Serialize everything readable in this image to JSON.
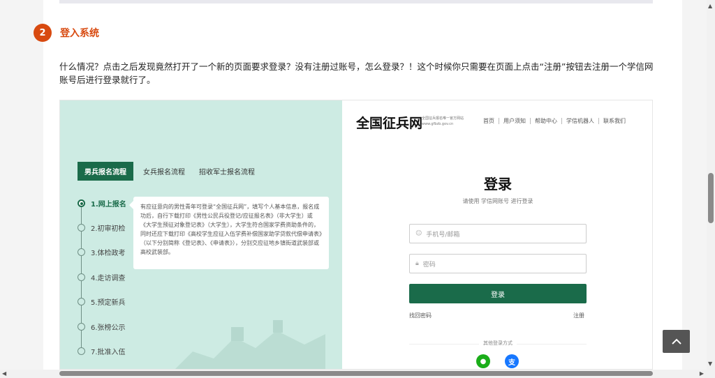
{
  "section": {
    "number": "2",
    "title": "登入系统"
  },
  "paragraph": "什么情况？点击之后发现竟然打开了一个新的页面要求登录？没有注册过账号，怎么登录？！这个时候你只需要在页面上点击“注册”按钮去注册一个学信网账号后进行登录就行了。",
  "screenshot": {
    "tabs": [
      "男兵报名流程",
      "女兵报名流程",
      "招收军士报名流程"
    ],
    "steps": [
      "1.网上报名",
      "2.初审初检",
      "3.体检政考",
      "4.走访调查",
      "5.预定新兵",
      "6.张榜公示",
      "7.批准入伍"
    ],
    "info_text": "有应征意向的男性青年可登录“全国征兵网”，填写个人基本信息，报名成功后，自行下载打印《男性公民兵役登记/应征报名表》（非大学生）或《大学生预征对象登记表》（大学生），大学生符合国家学费资助条件的，同时还应下载打印《高校学生应征入伍学费补偿国家助学贷款代偿申请表》（以下分别简称《登记表》、《申请表》），分别交应征地乡镇街道武装部或高校武装部。",
    "logo": "全国征兵网",
    "logo_sub_1": "全国征兵报名唯一官方网站",
    "logo_sub_2": "www.gfbzb.gov.cn",
    "nav": [
      "首页",
      "用户须知",
      "帮助中心",
      "学信机器人",
      "联系我们"
    ],
    "login_title": "登录",
    "login_sub": "请使用 学信网账号 进行登录",
    "phone_placeholder": "手机号/邮箱",
    "password_placeholder": "密码",
    "login_button": "登录",
    "forgot": "找回密码",
    "register": "注册",
    "other_login": "其他登录方式"
  },
  "colors": {
    "accent": "#d84a10",
    "brand_green": "#1a6b4a",
    "panel_bg": "#cdebe3",
    "wechat": "#1aad19",
    "alipay": "#1677ff"
  }
}
